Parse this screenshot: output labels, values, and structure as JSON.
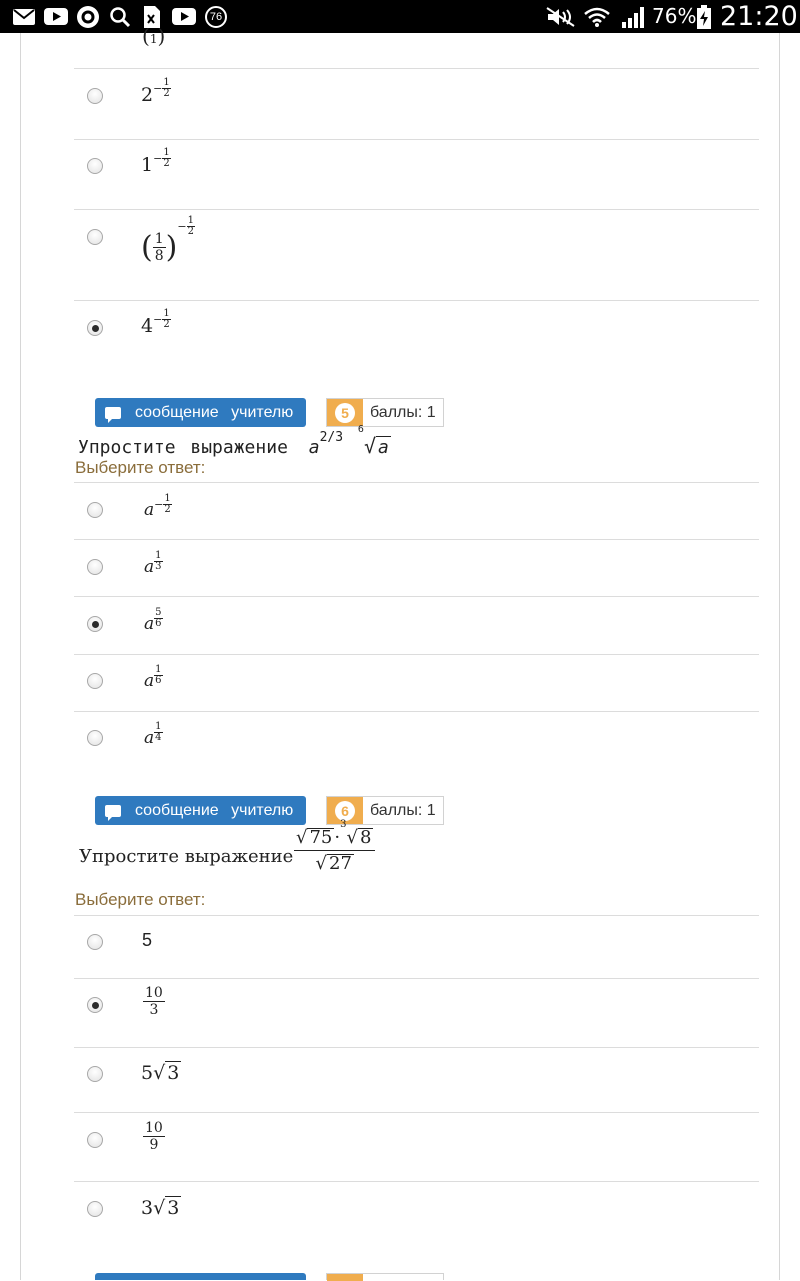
{
  "status_bar": {
    "notification_badge": "76",
    "battery": "76%",
    "time": "21:20"
  },
  "question4": {
    "options": [
      {
        "base": "2",
        "exponent": "−1/2",
        "exp_num": "1",
        "exp_den": "2",
        "selected": false
      },
      {
        "base": "1",
        "exponent": "−1/2",
        "exp_num": "1",
        "exp_den": "2",
        "selected": false
      },
      {
        "base": "(1/8)",
        "base_num": "1",
        "base_den": "8",
        "exponent": "−1/2",
        "exp_num": "1",
        "exp_den": "2",
        "selected": false
      },
      {
        "base": "4",
        "exponent": "−1/2",
        "exp_num": "1",
        "exp_den": "2",
        "selected": true
      }
    ]
  },
  "question5": {
    "message_button": "сообщение учителю",
    "number": "5",
    "points": "баллы: 1",
    "prompt": "Упростите выражение",
    "prompt_expr": "a^{2/3} ⁶√a",
    "expr_base": "a",
    "expr_exp": "2/3",
    "expr_root_index": "6",
    "expr_radicand": "a",
    "choose_label": "Выберите ответ:",
    "options": [
      {
        "base": "a",
        "exponent": "−1/2",
        "exp_num": "1",
        "exp_den": "2",
        "selected": false
      },
      {
        "base": "a",
        "exponent": "1/3",
        "exp_num": "1",
        "exp_den": "3",
        "selected": false
      },
      {
        "base": "a",
        "exponent": "5/6",
        "exp_num": "5",
        "exp_den": "6",
        "selected": true
      },
      {
        "base": "a",
        "exponent": "1/6",
        "exp_num": "1",
        "exp_den": "6",
        "selected": false
      },
      {
        "base": "a",
        "exponent": "1/4",
        "exp_num": "1",
        "exp_den": "4",
        "selected": false
      }
    ]
  },
  "question6": {
    "message_button": "сообщение учителю",
    "number": "6",
    "points": "баллы: 1",
    "prompt": "Упростите выражение",
    "prompt_expr": "(√75 · ∛8) / √27",
    "expr_num_a": "75",
    "expr_num_root_index": "3",
    "expr_num_b": "8",
    "expr_den": "27",
    "choose_label": "Выберите ответ:",
    "options": [
      {
        "answer": "5",
        "selected": false
      },
      {
        "answer": "10/3",
        "num": "10",
        "den": "3",
        "selected": true
      },
      {
        "answer": "5√3",
        "coef": "5",
        "radicand": "3",
        "selected": false
      },
      {
        "answer": "10/9",
        "num": "10",
        "den": "9",
        "selected": false
      },
      {
        "answer": "3√3",
        "coef": "3",
        "radicand": "3",
        "selected": false
      }
    ]
  }
}
